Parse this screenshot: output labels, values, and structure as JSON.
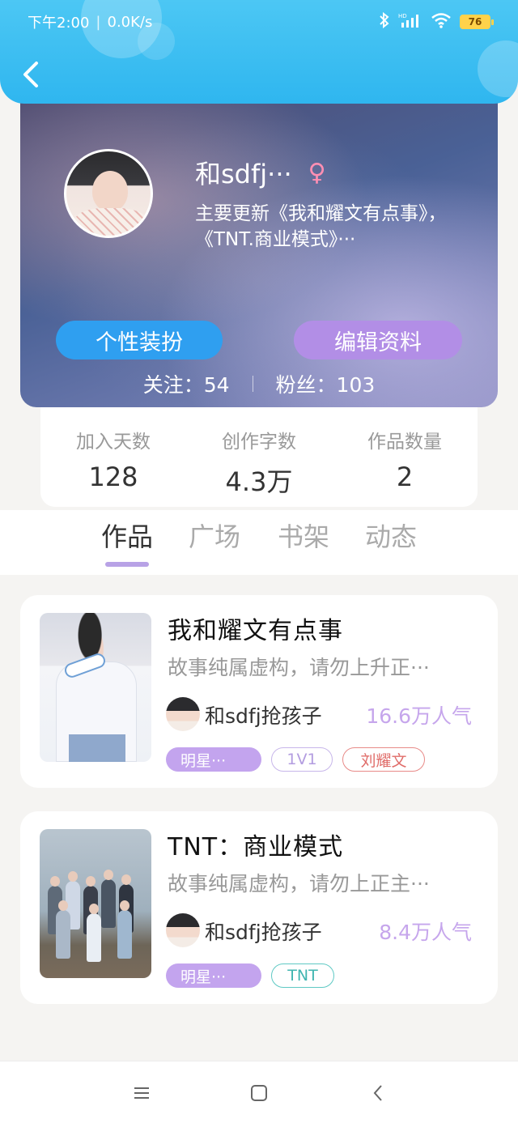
{
  "status_bar": {
    "time": "下午2:00",
    "speed": "0.0K/s",
    "battery": "76"
  },
  "profile": {
    "username": "和sdfj···",
    "description": "主要更新《我和耀文有点事》，《TNT.商业模式》···",
    "buttons": {
      "outfit": "个性装扮",
      "edit": "编辑资料"
    },
    "following": "关注：54",
    "followers": "粉丝：103"
  },
  "stats": [
    {
      "label": "加入天数",
      "value": "128"
    },
    {
      "label": "创作字数",
      "value": "4.3万"
    },
    {
      "label": "作品数量",
      "value": "2"
    }
  ],
  "tabs": [
    "作品",
    "广场",
    "书架",
    "动态"
  ],
  "books": [
    {
      "title": "我和耀文有点事",
      "desc": "故事纯属虚构，请勿上升正···",
      "author": "和sdfj抢孩子",
      "popularity": "16.6万人气",
      "tags": [
        "明星···",
        "1V1",
        "刘耀文"
      ]
    },
    {
      "title": "TNT：商业模式",
      "desc": "故事纯属虚构，请勿上正主···",
      "author": "和sdfj抢孩子",
      "popularity": "8.4万人气",
      "tags": [
        "明星···",
        "TNT"
      ]
    }
  ],
  "icons": {
    "back": "chevron-left-icon",
    "female": "female-icon",
    "bluetooth": "bluetooth-icon",
    "signal": "signal-icon",
    "wifi": "wifi-icon",
    "battery": "battery-icon",
    "nav_menu": "menu-icon",
    "nav_home": "home-square-icon",
    "nav_back": "back-triangle-icon"
  },
  "colors": {
    "header": "#2fb6ef",
    "outfit_button": "#2f9ff0",
    "edit_button": "#b28ee6",
    "popularity": "#c6a6ec"
  }
}
